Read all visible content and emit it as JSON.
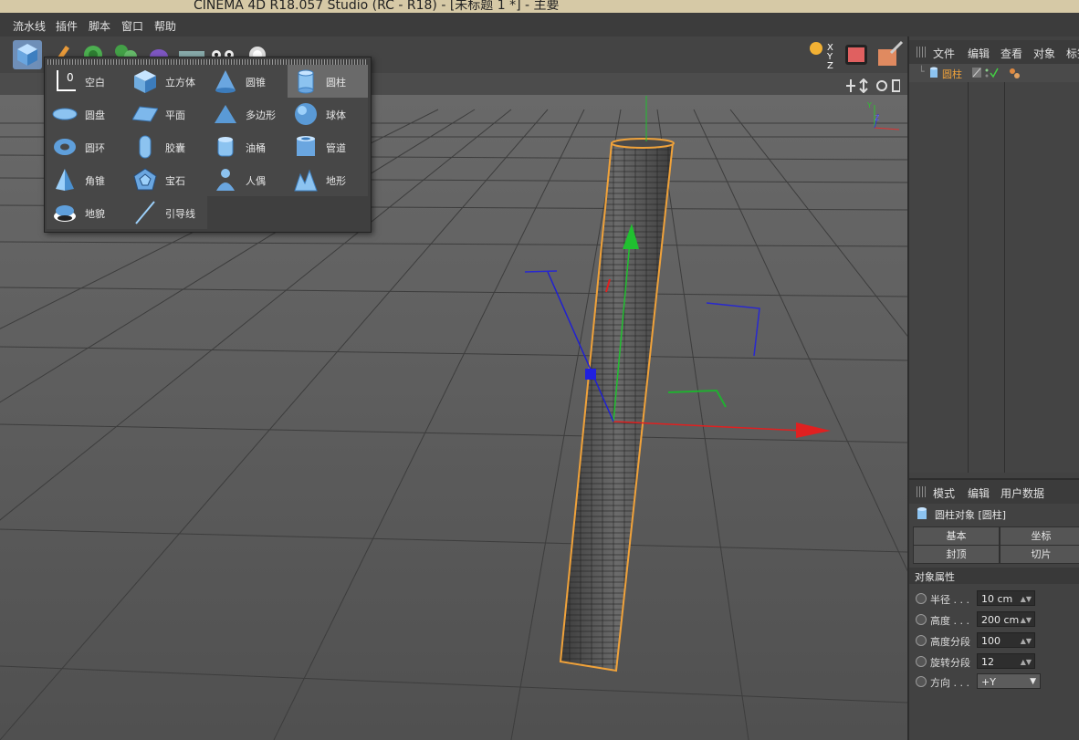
{
  "window": {
    "title": "CINEMA 4D R18.057 Studio (RC - R18) - [未标题 1 *] - 主要"
  },
  "menubar": {
    "items": [
      "流水线",
      "插件",
      "脚本",
      "窗口",
      "帮助"
    ]
  },
  "toolbar": {
    "axis_labels": [
      "X",
      "Y",
      "Z"
    ]
  },
  "popup": {
    "columns": [
      [
        {
          "label": "空白",
          "icon": "null-object-icon"
        },
        {
          "label": "圆盘",
          "icon": "disc-icon"
        },
        {
          "label": "圆环",
          "icon": "torus-icon"
        },
        {
          "label": "角锥",
          "icon": "pyramid-icon"
        },
        {
          "label": "地貌",
          "icon": "landscape-icon"
        }
      ],
      [
        {
          "label": "立方体",
          "icon": "cube-icon"
        },
        {
          "label": "平面",
          "icon": "plane-icon"
        },
        {
          "label": "胶囊",
          "icon": "capsule-icon"
        },
        {
          "label": "宝石",
          "icon": "platonic-icon"
        },
        {
          "label": "引导线",
          "icon": "guide-icon"
        }
      ],
      [
        {
          "label": "圆锥",
          "icon": "cone-icon"
        },
        {
          "label": "多边形",
          "icon": "polygon-icon"
        },
        {
          "label": "油桶",
          "icon": "oil-tank-icon"
        },
        {
          "label": "人偶",
          "icon": "figure-icon"
        }
      ],
      [
        {
          "label": "圆柱",
          "icon": "cylinder-icon",
          "selected": true
        },
        {
          "label": "球体",
          "icon": "sphere-icon"
        },
        {
          "label": "管道",
          "icon": "tube-icon"
        },
        {
          "label": "地形",
          "icon": "terrain-icon"
        }
      ]
    ]
  },
  "viewport": {
    "axis_labels": [
      "Y",
      "Z"
    ]
  },
  "object_manager": {
    "menu": [
      "文件",
      "编辑",
      "查看",
      "对象",
      "标签"
    ],
    "objects": [
      {
        "name": "圆柱"
      }
    ]
  },
  "attribute_manager": {
    "menu": [
      "模式",
      "编辑",
      "用户数据"
    ],
    "object_title": "圆柱对象 [圆柱]",
    "tabs": [
      "基本",
      "坐标",
      "封顶",
      "切片"
    ],
    "section_title": "对象属性",
    "properties": [
      {
        "label": "半径 . . .",
        "value": "10 cm"
      },
      {
        "label": "高度 . . .",
        "value": "200 cm"
      },
      {
        "label": "高度分段",
        "value": "100"
      },
      {
        "label": "旋转分段",
        "value": "12"
      },
      {
        "label": "方向 . . .",
        "value": "+Y"
      }
    ]
  },
  "colors": {
    "accent": "#f0a23a",
    "selection": "#6a6a6a",
    "axis_x": "#e02020",
    "axis_y": "#20c030",
    "axis_z": "#2020d0"
  }
}
